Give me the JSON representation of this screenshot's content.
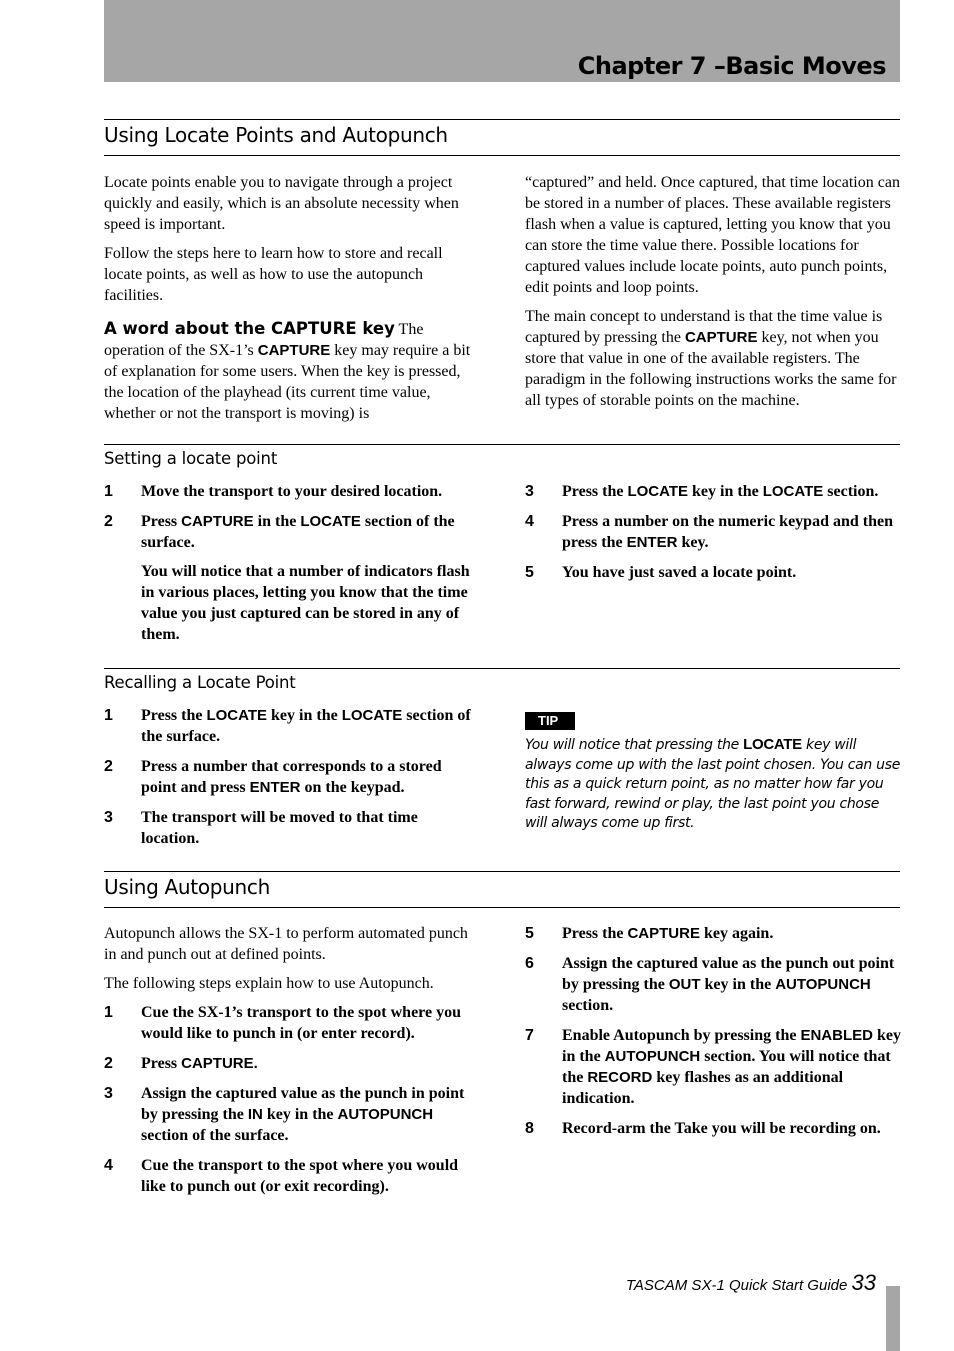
{
  "header": {
    "chapter_title": "Chapter 7 –Basic Moves"
  },
  "section1": {
    "title": "Using Locate Points and Autopunch",
    "left": {
      "p1": "Locate points enable you to navigate through a project quickly and easily, which is an absolute necessity when speed is important.",
      "p2": "Follow the steps here to learn how to store and recall locate points, as well as how to use the autopunch facilities.",
      "runin_heading": "A word about the CAPTURE key",
      "p3_a": " The operation of the SX-1’s ",
      "p3_key": "CAPTURE",
      "p3_b": " key may require a bit of explanation for some users. When the key is pressed, the location of the playhead (its current time value, whether or not the transport is moving) is"
    },
    "right": {
      "p1": "“captured” and held. Once captured, that time location can be stored in a number of places. These available registers flash when a value is captured, letting you know that you can store the time value there. Possible locations for captured values include locate points, auto punch points, edit points and loop points.",
      "p2_a": "The main concept to understand is that the time value is captured by pressing the ",
      "p2_key": "CAPTURE",
      "p2_b": " key, not when you store that value in one of the available registers. The paradigm in the following instructions works the same for all types of storable points on the machine."
    }
  },
  "setting": {
    "title": "Setting a locate point",
    "steps": [
      {
        "num": "1",
        "text": "Move the transport to your desired location."
      },
      {
        "num": "2",
        "a": "Press ",
        "k1": "CAPTURE",
        "b": " in the ",
        "k2": "LOCATE",
        "c": " section of the surface.",
        "cont": "You will notice that a number of indicators flash in various places, letting you know that the time value you just captured can be stored in any of them."
      },
      {
        "num": "3",
        "a": "Press the ",
        "k1": "LOCATE",
        "b": " key in the ",
        "k2": "LOCATE",
        "c": " section."
      },
      {
        "num": "4",
        "a": "Press a number on the numeric keypad and then press the ",
        "k1": "ENTER",
        "b": " key."
      },
      {
        "num": "5",
        "text": "You have just saved a locate point."
      }
    ]
  },
  "recalling": {
    "title": "Recalling a Locate Point",
    "steps": [
      {
        "num": "1",
        "a": "Press the ",
        "k1": "LOCATE",
        "b": " key in the ",
        "k2": "LOCATE",
        "c": " section of the surface."
      },
      {
        "num": "2",
        "a": "Press a number that corresponds to a stored point and press ",
        "k1": "ENTER",
        "b": " on the keypad."
      },
      {
        "num": "3",
        "text": "The transport will be moved to that time location."
      }
    ],
    "tip": {
      "badge": "TIP",
      "a": "You will notice that pressing the ",
      "key": "LOCATE",
      "b": " key will always come up with the last point chosen. You can use this as a quick return point, as no matter how far you fast forward, rewind or play, the last point you chose will always come up first."
    }
  },
  "autopunch": {
    "title": "Using Autopunch",
    "p1": "Autopunch allows the SX-1 to perform automated punch in and punch out at defined points.",
    "p2": "The following steps explain how to use Autopunch.",
    "steps": [
      {
        "num": "1",
        "text": "Cue the SX-1’s transport to the spot where you would like to punch in (or enter record)."
      },
      {
        "num": "2",
        "a": "Press ",
        "k1": "CAPTURE."
      },
      {
        "num": "3",
        "a": "Assign the captured value as the punch in point by pressing the ",
        "k1": "IN",
        "b": " key in the ",
        "k2": "AUTOPUNCH",
        "c": " section of the surface."
      },
      {
        "num": "4",
        "text": "Cue the transport to the spot where you would like to punch out (or exit recording)."
      },
      {
        "num": "5",
        "a": "Press the ",
        "k1": "CAPTURE",
        "b": " key again."
      },
      {
        "num": "6",
        "a": "Assign the captured value as the punch out point by pressing the ",
        "k1": "OUT",
        "b": " key in the ",
        "k2": "AUTOPUNCH",
        "c": " section."
      },
      {
        "num": "7",
        "a": "Enable Autopunch by pressing the ",
        "k1": "ENABLED",
        "b": " key in the ",
        "k2": "AUTOPUNCH",
        "c": " section. You will notice that the ",
        "k3": "RECORD",
        "d": " key flashes as an additional indication."
      },
      {
        "num": "8",
        "text": "Record-arm the Take you will be recording on."
      }
    ]
  },
  "footer": {
    "guide": "TASCAM SX-1 Quick Start Guide",
    "page": "33"
  }
}
